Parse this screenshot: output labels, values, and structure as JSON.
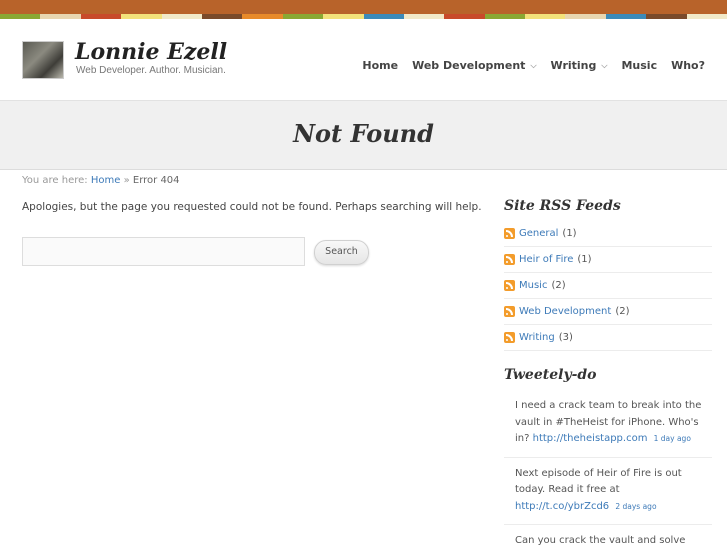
{
  "colors": {
    "accent_link": "#3d7ab8",
    "top_bar": "#b8632a",
    "stripe_colors": [
      "#8aa833",
      "#e8d6b0",
      "#c84a2a",
      "#f3e27a",
      "#f1e9c8",
      "#7a4a2a",
      "#e88a2a",
      "#8aa833",
      "#f3e27a",
      "#3c8ab8",
      "#f1e9c8",
      "#c84a2a",
      "#8aa833",
      "#f3e27a",
      "#e8d6b0",
      "#3c8ab8",
      "#7a4a2a",
      "#f1e9c8"
    ]
  },
  "header": {
    "avatar_icon": "author-photo",
    "site_title": "Lonnie Ezell",
    "tagline": "Web Developer. Author. Musician."
  },
  "nav": {
    "items": [
      {
        "label": "Home"
      },
      {
        "label": "Web Development"
      },
      {
        "label": "Writing"
      },
      {
        "label": "Music"
      },
      {
        "label": "Who?"
      }
    ],
    "chevron_icon": "chevron-down-icon"
  },
  "page": {
    "title": "Not Found"
  },
  "breadcrumb": {
    "prefix": "You are here:",
    "home": "Home",
    "sep": "»",
    "current": "Error 404"
  },
  "main": {
    "message": "Apologies, but the page you requested could not be found. Perhaps searching will help.",
    "search_value": "",
    "search_button": "Search"
  },
  "sidebar": {
    "rss_title": "Site RSS Feeds",
    "feeds": [
      {
        "name": "General",
        "count": "(1)"
      },
      {
        "name": "Heir of Fire",
        "count": "(1)"
      },
      {
        "name": "Music",
        "count": "(2)"
      },
      {
        "name": "Web Development",
        "count": "(2)"
      },
      {
        "name": "Writing",
        "count": "(3)"
      }
    ],
    "rss_icon": "rss-icon",
    "tweets_title": "Tweetely-do",
    "tweets": [
      {
        "text": "I need a crack team to break into the vault in #TheHeist for iPhone. Who's in?",
        "link": "http://theheistapp.com",
        "time": "1 day ago"
      },
      {
        "text": "Next episode of Heir of Fire is out today. Read it free at",
        "link": "http://t.co/ybrZcd6",
        "time": "2 days ago"
      },
      {
        "text": "Can you crack the vault and solve",
        "link": "",
        "time": ""
      }
    ]
  }
}
